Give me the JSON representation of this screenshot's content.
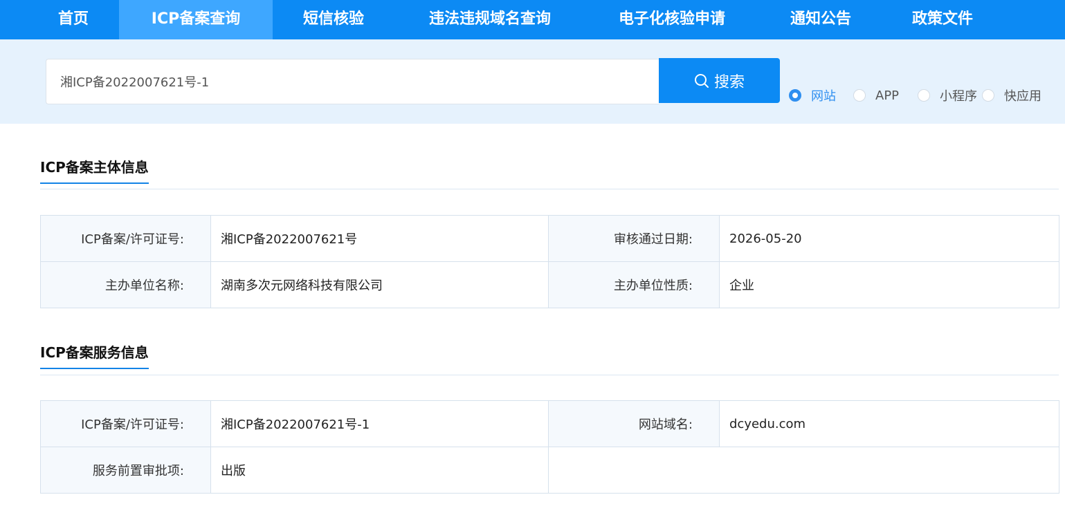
{
  "nav": {
    "items": [
      {
        "label": "首页"
      },
      {
        "label": "ICP备案查询",
        "active": true
      },
      {
        "label": "短信核验"
      },
      {
        "label": "违法违规域名查询"
      },
      {
        "label": "电子化核验申请"
      },
      {
        "label": "通知公告"
      },
      {
        "label": "政策文件"
      }
    ]
  },
  "search": {
    "value": "湘ICP备2022007621号-1",
    "button_label": "搜索",
    "button_icon": "search-icon",
    "options": [
      {
        "label": "网站",
        "checked": true
      },
      {
        "label": "APP",
        "checked": false
      },
      {
        "label": "小程序",
        "checked": false
      },
      {
        "label": "快应用",
        "checked": false
      }
    ]
  },
  "subject_section": {
    "title": "ICP备案主体信息",
    "rows": [
      {
        "k1": "ICP备案/许可证号:",
        "v1": "湘ICP备2022007621号",
        "k2": "审核通过日期:",
        "v2": "2026-05-20"
      },
      {
        "k1": "主办单位名称:",
        "v1": "湖南多次元网络科技有限公司",
        "k2": "主办单位性质:",
        "v2": "企业"
      }
    ]
  },
  "service_section": {
    "title": "ICP备案服务信息",
    "rows": [
      {
        "k1": "ICP备案/许可证号:",
        "v1": "湘ICP备2022007621号-1",
        "k2": "网站域名:",
        "v2": "dcyedu.com"
      },
      {
        "k1": "服务前置审批项:",
        "v1": "出版"
      }
    ]
  },
  "colors": {
    "nav_bg": "#0c8af4",
    "nav_active": "#3ea7ff",
    "search_band": "#e6f2fd",
    "accent": "#2f8ff0"
  }
}
